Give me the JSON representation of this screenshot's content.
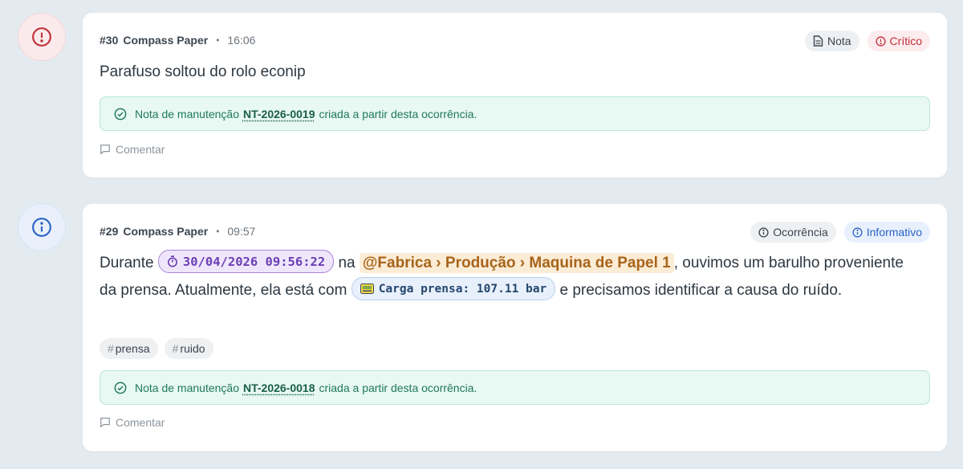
{
  "colors": {
    "critical": "#c0313a",
    "info": "#2c63c6",
    "success": "#1f7a5a",
    "page_bg": "#e4ebf0"
  },
  "entries": [
    {
      "icon": "alert-circle-icon",
      "number": "#30",
      "author": "Compass Paper",
      "separator": "•",
      "time": "16:06",
      "badges": [
        {
          "icon": "document-icon",
          "label": "Nota"
        },
        {
          "icon": "alert-circle-icon",
          "label": "Crítico"
        }
      ],
      "text": "Parafuso soltou do rolo econip",
      "note": {
        "prefix": "Nota de manutenção",
        "code": "NT-2026-0019",
        "suffix": "criada a partir desta ocorrência."
      },
      "comment_label": "Comentar"
    },
    {
      "icon": "info-circle-icon",
      "number": "#29",
      "author": "Compass Paper",
      "separator": "•",
      "time": "09:57",
      "badges": [
        {
          "icon": "info-circle-icon",
          "label": "Ocorrência"
        },
        {
          "icon": "info-circle-icon",
          "label": "Informativo"
        }
      ],
      "text_parts": {
        "t1": "Durante",
        "timestamp_chip": "30/04/2026 09:56:22",
        "t2": "na",
        "mention": "@Fabrica › Produção › Maquina de Papel 1",
        "t3": ", ouvimos um barulho proveniente da prensa. Atualmente, ela está com",
        "sensor_chip": "Carga prensa: 107.11 bar",
        "t4": "e precisamos identificar a causa do ruído."
      },
      "tags": [
        "prensa",
        "ruido"
      ],
      "tag_prefix": "#",
      "note": {
        "prefix": "Nota de manutenção",
        "code": "NT-2026-0018",
        "suffix": "criada a partir desta ocorrência."
      },
      "comment_label": "Comentar"
    }
  ]
}
